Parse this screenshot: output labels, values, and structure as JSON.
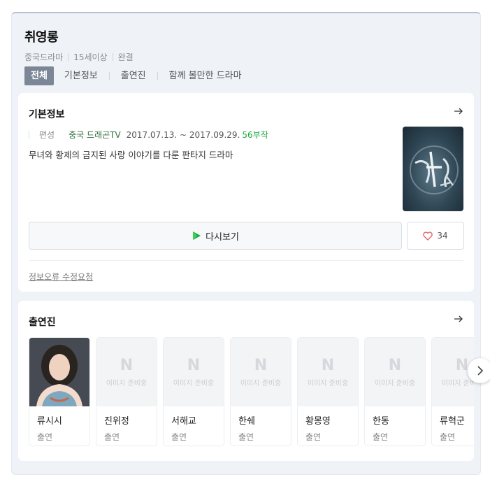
{
  "header": {
    "title": "취영롱",
    "meta": [
      "중국드라마",
      "15세이상",
      "완결"
    ]
  },
  "tabs": [
    {
      "label": "전체",
      "active": true
    },
    {
      "label": "기본정보",
      "active": false
    },
    {
      "label": "출연진",
      "active": false
    },
    {
      "label": "함께 볼만한 드라마",
      "active": false
    }
  ],
  "info": {
    "title": "기본정보",
    "broadcast_label": "편성",
    "network": "중국 드래곤TV",
    "dates": "2017.07.13. ~ 2017.09.29.",
    "episodes": "56부작",
    "description": "무녀와 황제의 금지된 사랑 이야기를 다룬 판타지 드라마",
    "watch_label": "다시보기",
    "like_count": "34",
    "report_label": "정보오류 수정요청"
  },
  "cast": {
    "title": "출연진",
    "placeholder_letter": "N",
    "placeholder_text": "이미지 준비중",
    "items": [
      {
        "name": "류시시",
        "role": "출연",
        "has_photo": true
      },
      {
        "name": "진위정",
        "role": "출연",
        "has_photo": false
      },
      {
        "name": "서해교",
        "role": "출연",
        "has_photo": false
      },
      {
        "name": "한쉐",
        "role": "출연",
        "has_photo": false
      },
      {
        "name": "황몽영",
        "role": "출연",
        "has_photo": false
      },
      {
        "name": "한동",
        "role": "출연",
        "has_photo": false
      },
      {
        "name": "류혁군",
        "role": "출연",
        "has_photo": false
      }
    ]
  },
  "colors": {
    "accent_green": "#1aa83c",
    "tab_active_bg": "#7b8797",
    "heart": "#e35a5a"
  },
  "icons": {
    "arrow": "arrow-right-icon",
    "play": "play-icon",
    "heart": "heart-icon",
    "next": "chevron-right-icon"
  }
}
